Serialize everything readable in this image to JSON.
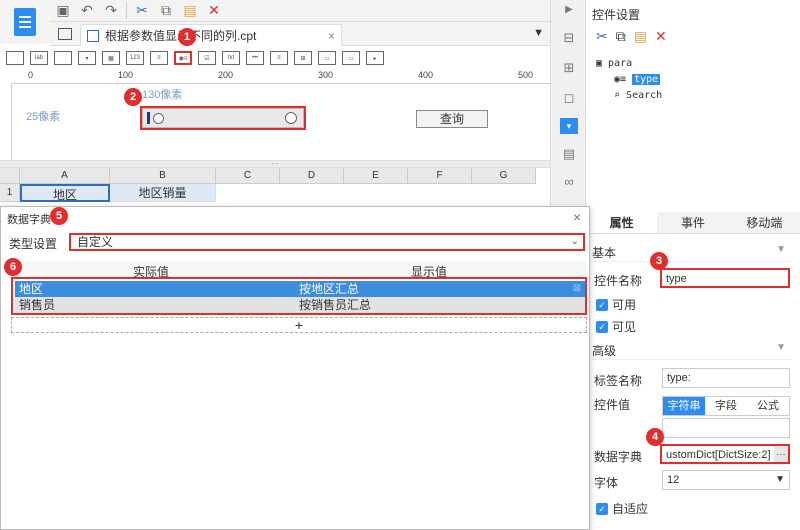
{
  "tab": {
    "title": "根据参数值显示不同的列.cpt"
  },
  "ruler": {
    "ticks": [
      "0",
      "100",
      "200",
      "300",
      "400",
      "500"
    ]
  },
  "param_area": {
    "label_top": "130像素",
    "label_left": "25像素",
    "query_button": "查询"
  },
  "sheet": {
    "columns": [
      "A",
      "B",
      "C",
      "D",
      "E",
      "F",
      "G"
    ],
    "rows": [
      {
        "num": "1",
        "cells": [
          "地区",
          "地区销量"
        ]
      }
    ]
  },
  "right_panel": {
    "title": "控件设置",
    "tree": {
      "root": "para",
      "child_type": "type",
      "child_search": "Search"
    },
    "tabs": [
      "属性",
      "事件",
      "移动端"
    ],
    "sections": {
      "basic": "基本",
      "advanced": "高级"
    },
    "widget_name_label": "控件名称",
    "widget_name_value": "type",
    "enabled_label": "可用",
    "visible_label": "可见",
    "tag_name_label": "标签名称",
    "tag_name_value": "type:",
    "widget_value_label": "控件值",
    "value_options": [
      "字符串",
      "字段",
      "公式"
    ],
    "dict_label": "数据字典",
    "dict_value": "ustomDict[DictSize:2]",
    "dict_btn": "···",
    "font_label": "字体",
    "font_value": "12",
    "auto_fit_label": "自适应"
  },
  "dialog": {
    "title": "数据字典",
    "close": "×",
    "type_label": "类型设置",
    "type_value": "自定义",
    "columns": [
      "实际值",
      "显示值"
    ],
    "rows": [
      {
        "actual": "地区",
        "display": "按地区汇总"
      },
      {
        "actual": "销售员",
        "display": "按销售员汇总"
      }
    ],
    "add": "+"
  },
  "badges": [
    "1",
    "2",
    "3",
    "4",
    "5",
    "6"
  ],
  "colors": {
    "accent": "#2d8cf0",
    "highlight": "#e02e2e"
  }
}
